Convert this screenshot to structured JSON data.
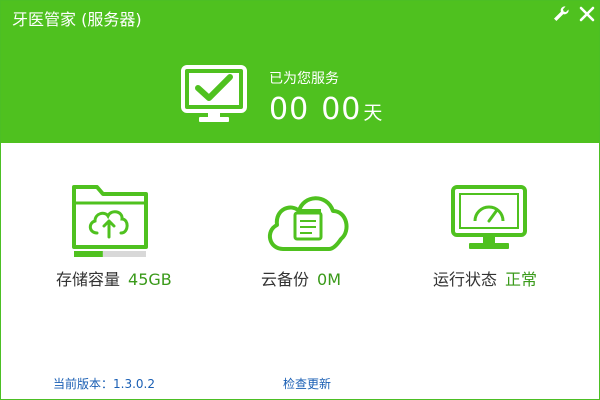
{
  "window": {
    "title": "牙医管家 (服务器)"
  },
  "header": {
    "service_label": "已为您服务",
    "days_a": "00",
    "days_b": "00",
    "days_unit": "天",
    "icons": {
      "settings": "wrench-icon",
      "close": "close-icon",
      "main": "monitor-check-icon"
    }
  },
  "features": {
    "storage": {
      "label": "存储容量",
      "value": "45GB",
      "icon": "folder-cloud-icon",
      "usage_fraction": 0.4
    },
    "backup": {
      "label": "云备份",
      "value": "0M",
      "icon": "cloud-icon"
    },
    "status": {
      "label": "运行状态",
      "value": "正常",
      "icon": "monitor-gauge-icon"
    }
  },
  "footer": {
    "version": "当前版本：1.3.0.2",
    "check_update": "检查更新"
  },
  "colors": {
    "brand_green": "#4fc11f",
    "value_green": "#3a9a1a",
    "link_blue": "#1a5fb4"
  }
}
